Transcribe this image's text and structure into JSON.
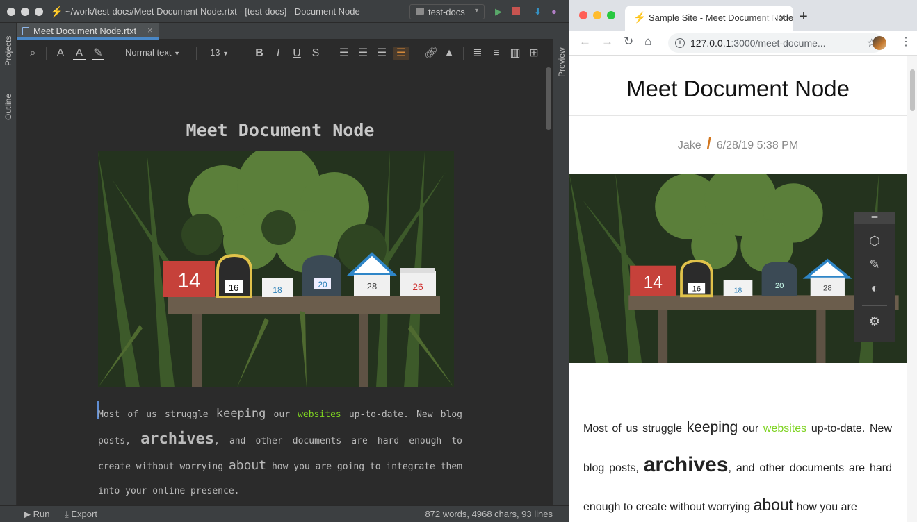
{
  "ide": {
    "window_title": "~/work/test-docs/Meet Document Node.rtxt - [test-docs] - Document Node",
    "project_selector": "test-docs",
    "left_strip": {
      "projects": "Projects",
      "outline": "Outline"
    },
    "right_strip": {
      "preview": "Preview"
    },
    "tab": {
      "label": "Meet Document Node.rtxt"
    },
    "toolbar": {
      "style": "Normal text",
      "font_size": "13",
      "bold": "B",
      "italic": "I",
      "underline": "U",
      "strike": "S"
    },
    "document": {
      "title": "Meet Document Node",
      "para": {
        "t1": "Most of us struggle ",
        "t2": "keeping",
        "t3": " our ",
        "t4": "websites",
        "t5": " up-to-date. New blog posts, ",
        "t6": "archives",
        "t7": ", and other documents are hard enough to create without worrying ",
        "t8": "about",
        "t9": " how you are going to integrate them into your online presence."
      },
      "mailbox_numbers": [
        "14",
        "16",
        "18",
        "20",
        "28",
        "26"
      ]
    },
    "status": {
      "run": "Run",
      "export": "Export",
      "counts": "872 words, 4968 chars, 93 lines"
    },
    "colors": {
      "link": "#7ed321",
      "accent": "#4a88c7"
    }
  },
  "browser": {
    "tab_title": "Sample Site - Meet Document Node",
    "url_host": "127.0.0.1",
    "url_rest": ":3000/meet-docume...",
    "page": {
      "title": "Meet Document Node",
      "author": "Jake",
      "separator": "/",
      "date": "6/28/19 5:38 PM",
      "para": {
        "t1": "Most of us struggle ",
        "t2": "keeping",
        "t3": " our ",
        "t4": "websites",
        "t5": " up-to-date. New blog posts, ",
        "t6": "archives",
        "t7": ", and other documents are hard enough to create without worrying ",
        "t8": "about",
        "t9": " how you are"
      }
    }
  }
}
